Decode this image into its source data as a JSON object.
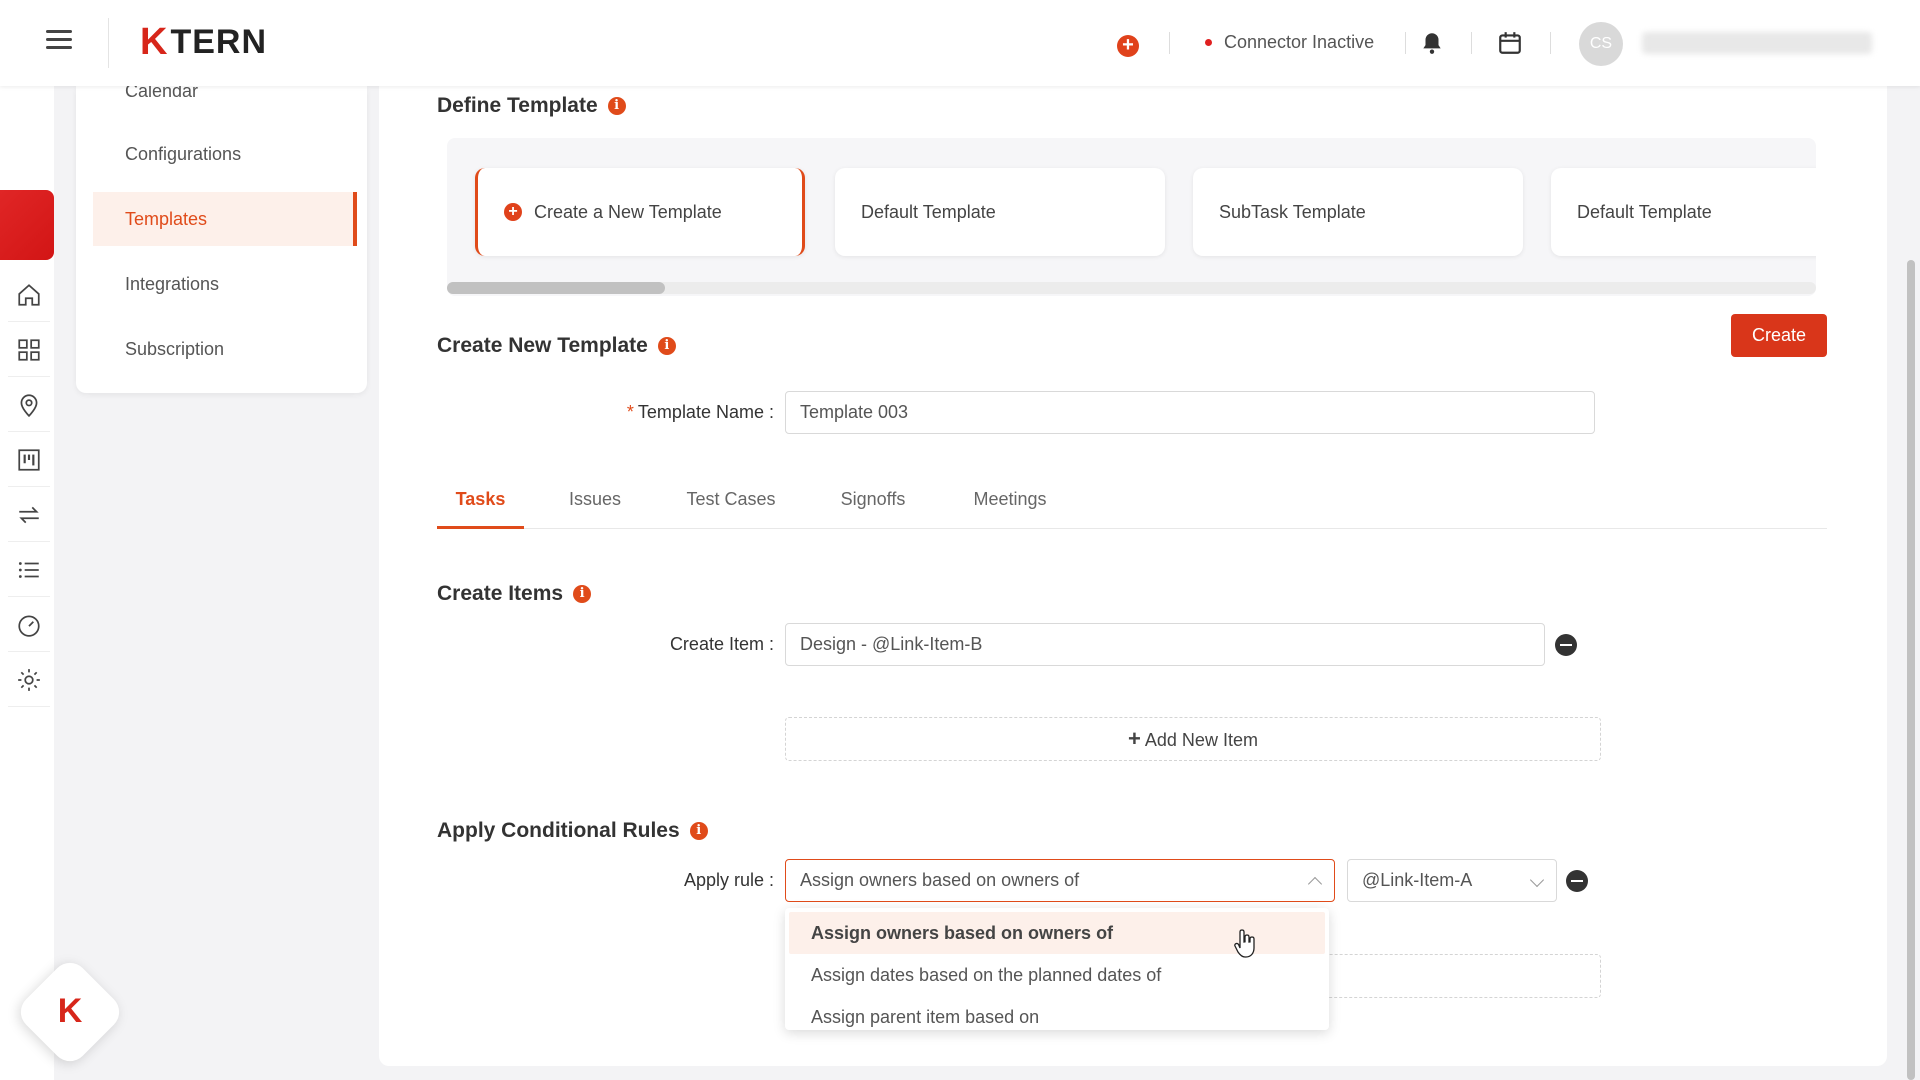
{
  "header": {
    "logo_k": "K",
    "logo_text": "TERN",
    "connector_status": "Connector Inactive",
    "avatar_initials": "CS"
  },
  "submenu": {
    "items": [
      {
        "label": "Calendar"
      },
      {
        "label": "Configurations"
      },
      {
        "label": "Templates",
        "active": true
      },
      {
        "label": "Integrations"
      },
      {
        "label": "Subscription"
      }
    ]
  },
  "define_template": {
    "title": "Define Template",
    "cards": [
      {
        "label": "Create a New Template",
        "selected": true
      },
      {
        "label": "Default Template"
      },
      {
        "label": "SubTask Template"
      },
      {
        "label": "Default Template"
      }
    ]
  },
  "create_new_template": {
    "title": "Create New Template",
    "create_button": "Create",
    "template_name_label": "Template Name",
    "template_name_value": "Template 003"
  },
  "tabs": [
    {
      "label": "Tasks",
      "active": true
    },
    {
      "label": "Issues"
    },
    {
      "label": "Test Cases"
    },
    {
      "label": "Signoffs"
    },
    {
      "label": "Meetings"
    }
  ],
  "create_items": {
    "title": "Create Items",
    "item_label": "Create Item",
    "item_value": "Design - @Link-Item-B",
    "add_new_label": "Add New Item"
  },
  "conditional_rules": {
    "title": "Apply Conditional Rules",
    "rule_label": "Apply rule",
    "rule_value": "Assign owners based on owners of",
    "link_value": "@Link-Item-A",
    "options": [
      "Assign owners based on owners of",
      "Assign dates based on the planned dates of",
      "Assign parent item based on"
    ]
  },
  "colors": {
    "accent": "#e04b1a",
    "brand_red": "#d7261a"
  }
}
